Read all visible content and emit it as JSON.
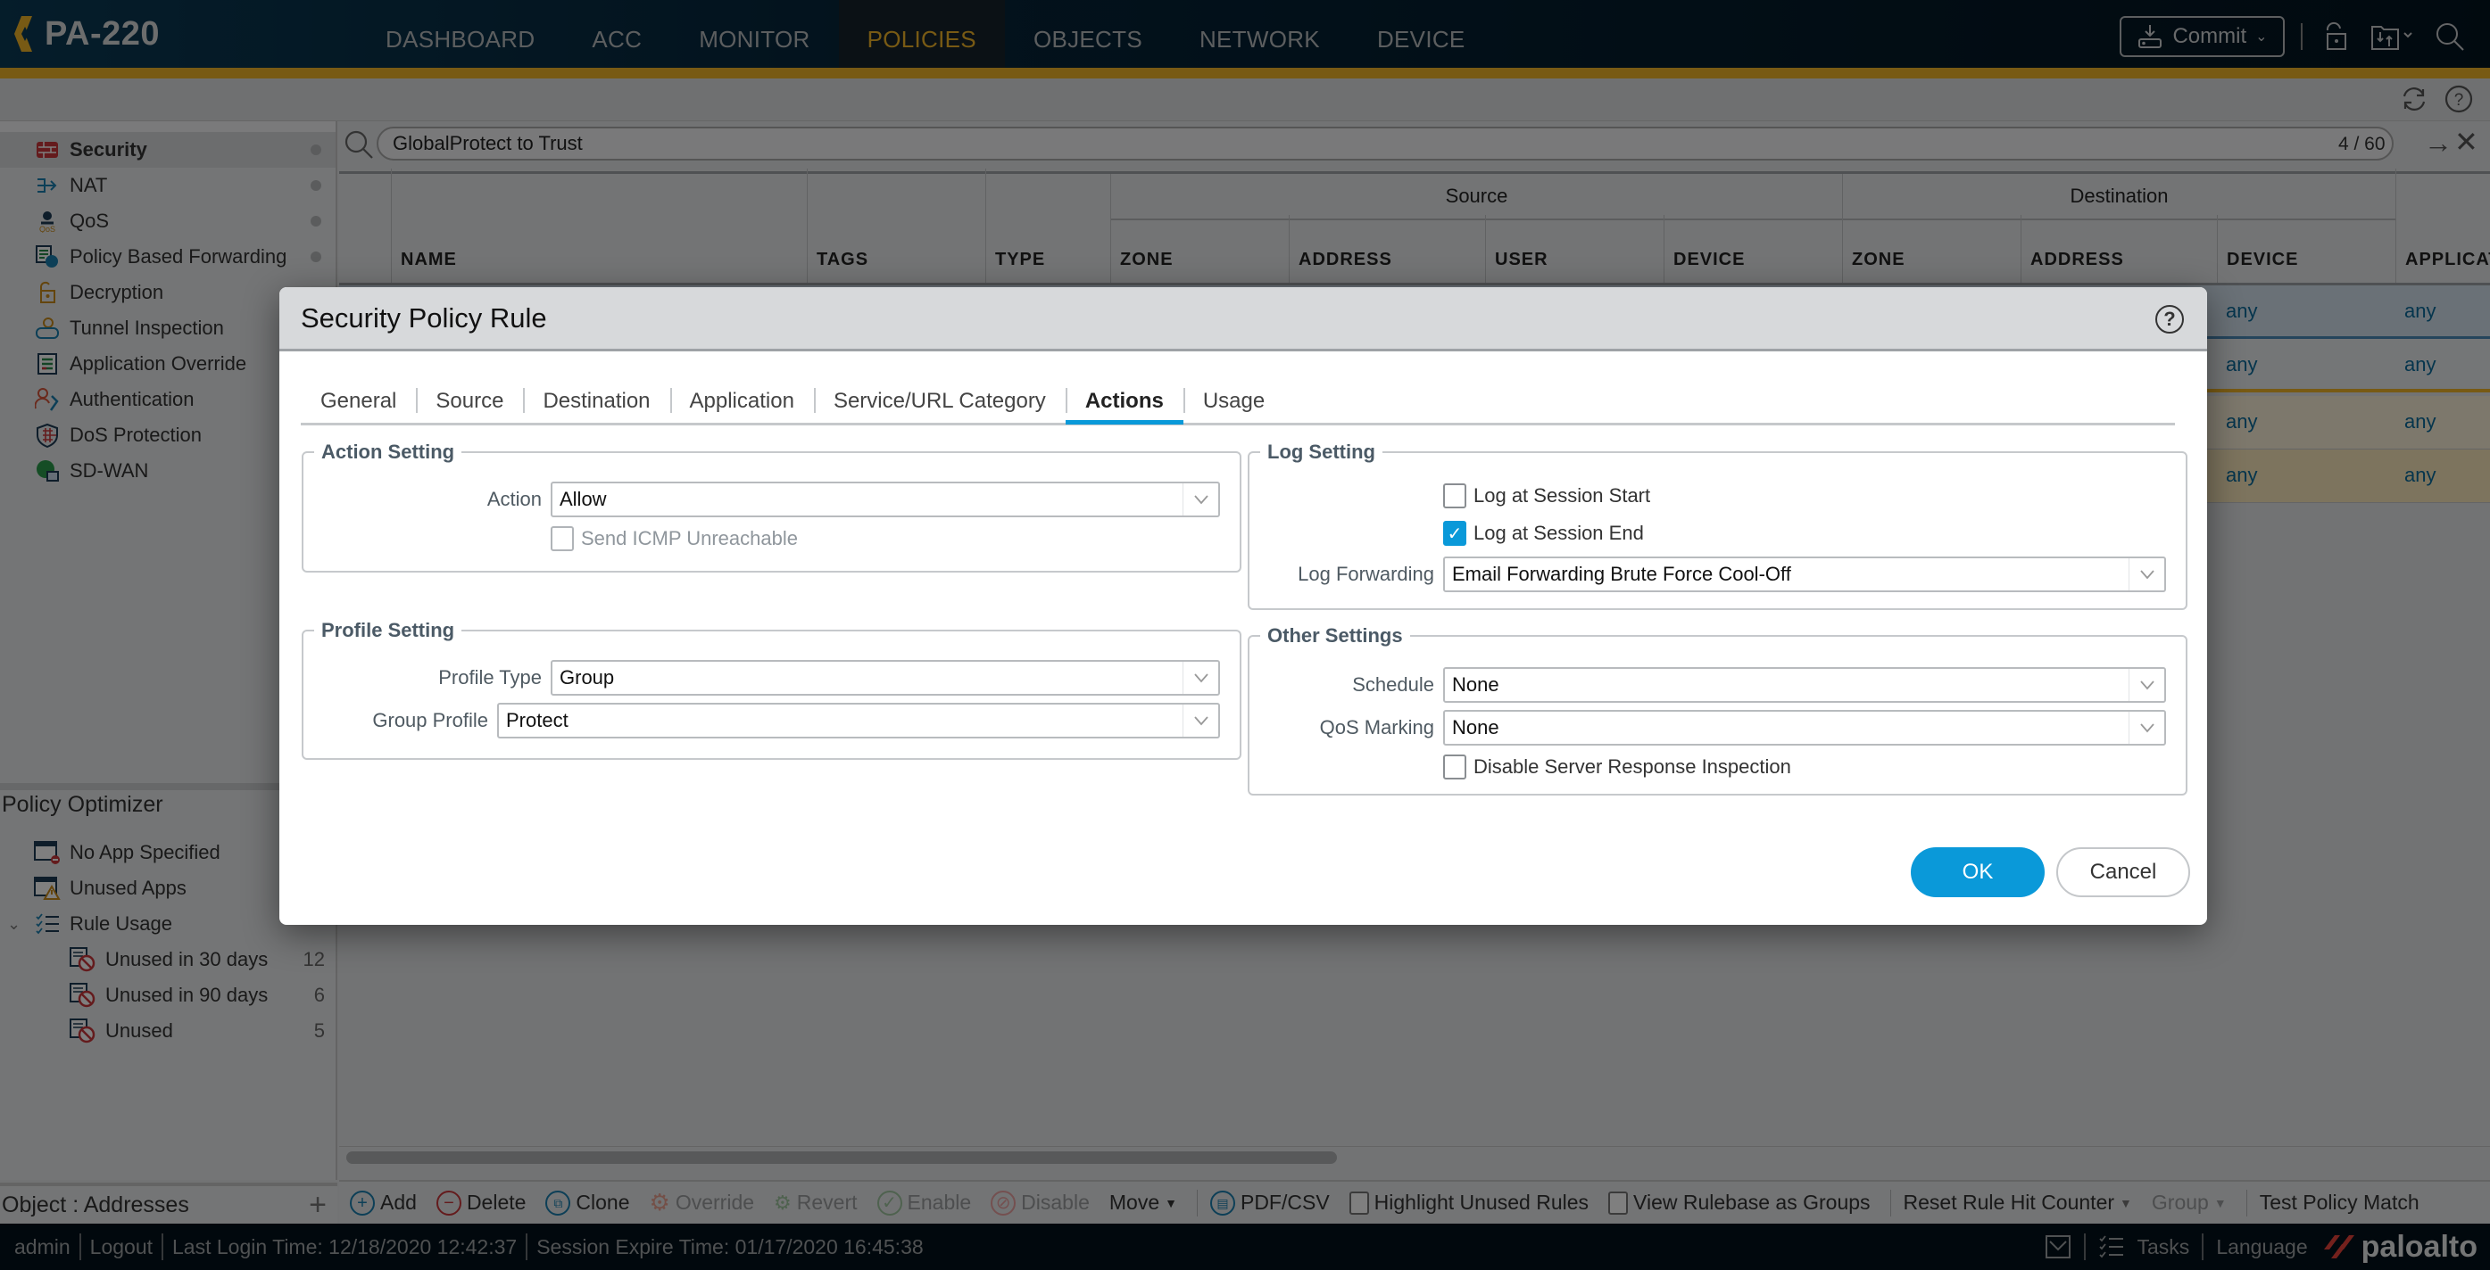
{
  "app": {
    "device_name": "PA-220",
    "nav_tabs": [
      {
        "label": "DASHBOARD",
        "active": false
      },
      {
        "label": "ACC",
        "active": false
      },
      {
        "label": "MONITOR",
        "active": false
      },
      {
        "label": "POLICIES",
        "active": true
      },
      {
        "label": "OBJECTS",
        "active": false
      },
      {
        "label": "NETWORK",
        "active": false
      },
      {
        "label": "DEVICE",
        "active": false
      }
    ],
    "commit_label": "Commit",
    "accent_gold": "#f0b429",
    "accent_blue": "#0a99d9"
  },
  "sidebar": {
    "items": [
      {
        "label": "Security",
        "icon": "firewall-icon",
        "active": true,
        "dot": true
      },
      {
        "label": "NAT",
        "icon": "nat-arrow-icon",
        "active": false,
        "dot": true
      },
      {
        "label": "QoS",
        "icon": "qos-icon",
        "active": false,
        "dot": true
      },
      {
        "label": "Policy Based Forwarding",
        "icon": "pbf-icon",
        "active": false,
        "dot": true
      },
      {
        "label": "Decryption",
        "icon": "unlock-icon",
        "active": false,
        "dot": false
      },
      {
        "label": "Tunnel Inspection",
        "icon": "tunnel-icon",
        "active": false,
        "dot": false
      },
      {
        "label": "Application Override",
        "icon": "app-override-icon",
        "active": false,
        "dot": false
      },
      {
        "label": "Authentication",
        "icon": "authentication-icon",
        "active": false,
        "dot": false
      },
      {
        "label": "DoS Protection",
        "icon": "shield-icon",
        "active": false,
        "dot": false
      },
      {
        "label": "SD-WAN",
        "icon": "sdwan-icon",
        "active": false,
        "dot": false
      }
    ],
    "optimizer": {
      "title": "Policy Optimizer",
      "items": [
        {
          "label": "No App Specified",
          "icon": "no-app-icon",
          "count": ""
        },
        {
          "label": "Unused Apps",
          "icon": "warning-app-icon",
          "count": ""
        },
        {
          "label": "Rule Usage",
          "icon": "checklist-icon",
          "count": "",
          "expanded": true
        },
        {
          "label": "Unused in 30 days",
          "icon": "unused-rule-icon",
          "count": "12"
        },
        {
          "label": "Unused in 90 days",
          "icon": "unused-rule-icon",
          "count": "6"
        },
        {
          "label": "Unused",
          "icon": "unused-rule-icon",
          "count": "5"
        }
      ]
    },
    "object_bar": "Object : Addresses"
  },
  "main": {
    "search": {
      "value": "GlobalProtect to Trust",
      "count": "4 / 60"
    },
    "table": {
      "groups": {
        "source": "Source",
        "destination": "Destination"
      },
      "columns": [
        "NAME",
        "TAGS",
        "TYPE",
        "ZONE",
        "ADDRESS",
        "USER",
        "DEVICE",
        "ZONE",
        "ADDRESS",
        "DEVICE",
        "APPLICAT"
      ],
      "rows": [
        {
          "dest_device": "any",
          "application": "any"
        },
        {
          "dest_device": "any",
          "application": "any"
        },
        {
          "dest_device": "any",
          "application": "any"
        },
        {
          "dest_device": "any",
          "application": "any"
        }
      ]
    }
  },
  "bottom_toolbar": {
    "add": "Add",
    "delete": "Delete",
    "clone": "Clone",
    "override": "Override",
    "revert": "Revert",
    "enable": "Enable",
    "disable": "Disable",
    "move": "Move",
    "pdf_csv": "PDF/CSV",
    "highlight_unused": "Highlight Unused Rules",
    "view_as_groups": "View Rulebase as Groups",
    "reset_counter": "Reset Rule Hit Counter",
    "group": "Group",
    "test_policy": "Test Policy Match"
  },
  "status_bar": {
    "user": "admin",
    "logout": "Logout",
    "last_login": "Last Login Time: 12/18/2020 12:42:37",
    "session_expire": "Session Expire Time: 01/17/2020 16:45:38",
    "tasks": "Tasks",
    "language": "Language",
    "logo_text": "paloalto"
  },
  "dialog": {
    "title": "Security Policy Rule",
    "tabs": [
      {
        "label": "General",
        "active": false
      },
      {
        "label": "Source",
        "active": false
      },
      {
        "label": "Destination",
        "active": false
      },
      {
        "label": "Application",
        "active": false
      },
      {
        "label": "Service/URL Category",
        "active": false
      },
      {
        "label": "Actions",
        "active": true
      },
      {
        "label": "Usage",
        "active": false
      }
    ],
    "action_setting": {
      "legend": "Action Setting",
      "action_label": "Action",
      "action_value": "Allow",
      "send_icmp_label": "Send ICMP Unreachable",
      "send_icmp_checked": false
    },
    "profile_setting": {
      "legend": "Profile Setting",
      "profile_type_label": "Profile Type",
      "profile_type_value": "Group",
      "group_profile_label": "Group Profile",
      "group_profile_value": "Protect"
    },
    "log_setting": {
      "legend": "Log Setting",
      "log_start_label": "Log at Session Start",
      "log_start_checked": false,
      "log_end_label": "Log at Session End",
      "log_end_checked": true,
      "log_forwarding_label": "Log Forwarding",
      "log_forwarding_value": "Email Forwarding Brute Force Cool-Off"
    },
    "other_settings": {
      "legend": "Other Settings",
      "schedule_label": "Schedule",
      "schedule_value": "None",
      "qos_label": "QoS Marking",
      "qos_value": "None",
      "disable_sri_label": "Disable Server Response Inspection",
      "disable_sri_checked": false
    },
    "ok_label": "OK",
    "cancel_label": "Cancel"
  }
}
